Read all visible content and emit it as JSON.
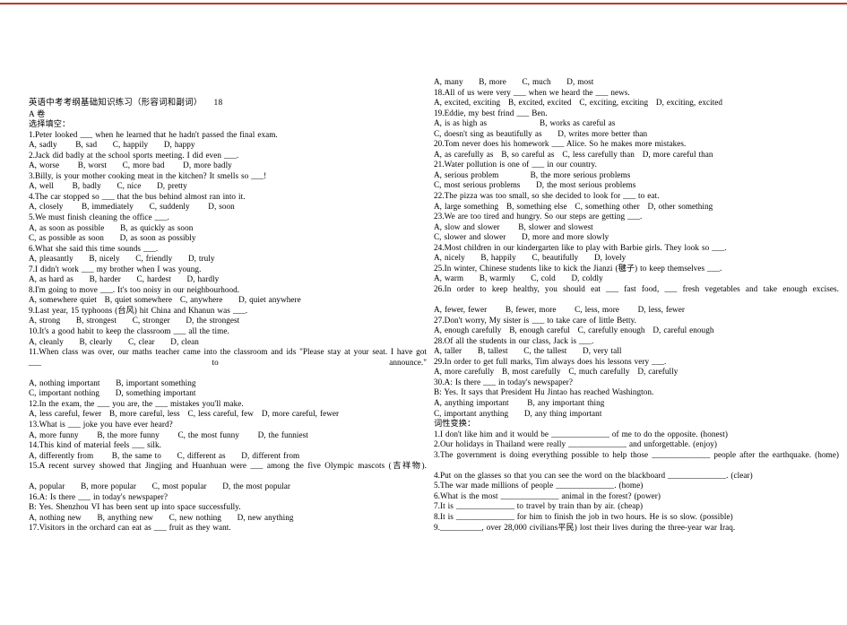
{
  "document": {
    "title": "英语中考考纲基础知识练习（形容词和副词）",
    "page_number": "18",
    "section_a": "A 卷",
    "section_a_heading": "选择填空：",
    "word_form_heading": "词性变换："
  },
  "left_column": {
    "lines": [
      "英语中考考纲基础知识练习（形容词和副词）    18",
      "A 卷",
      "选择填空：",
      "1.Peter looked ___ when he learned that he hadn't passed the final exam.",
      "A, sadly       B, sad      C, happily      D, happy",
      "2.Jack did badly at the school sports meeting. I did even ___.",
      "A, worse       B, worst      C, more bad       D, more badly",
      "3.Billy, is your mother cooking meat in the kitchen? It smells so ___!",
      "A, well       B, badly      C, nice      D, pretty",
      "4.The car stopped so ___ that the bus behind almost ran into it.",
      "A, closely       B, immediately      C, suddenly       D, soon",
      "5.We must finish cleaning the office ___.",
      "A, as soon as possible      B, as quickly as soon",
      "C, as possible as soon      D, as soon as possibly",
      "6.What she said this time sounds ___.",
      "A, pleasantly      B, nicely      C, friendly      D, truly",
      "7.I didn't work ___ my brother when I was young.",
      "A, as hard as      B, harder      C, hardest      D, hardly",
      "8.I'm going to move ___. It's too noisy in our neighbourhood.",
      "A, somewhere quiet   B, quiet somewhere   C, anywhere      D, quiet anywhere",
      "9.Last year, 15 typhoons (台风) hit China and Khanun was ___.",
      "A, strong      B, strongest      C, stronger      D, the strongest",
      "10.It's a good habit to keep the classroom ___ all the time.",
      "A, cleanly      B, clearly      C, clear      D, clean",
      "11.When class was over, our maths teacher came into the classroom and ids \"Please stay at your seat. I have got ___ to announce.\"",
      "A, nothing important      B, important something",
      "C, important nothing      D, something important",
      "12.In the exam, the ___ you are, the ___ mistakes you'll make.",
      "A, less careful, fewer   B, more careful, less   C, less careful, few   D, more careful, fewer",
      "13.What is ___ joke you have ever heard?",
      "A, more funny       B, the more funny       C, the most funny       D, the funniest",
      "14.This kind of material feels ___ silk.",
      "A, differently from       B, the same to      C, different as      D, different from",
      "15.A recent survey showed that Jingjing and Huanhuan were ___ among the five Olympic mascots (吉祥物).",
      "A, popular      B, more popular      C, most popular      D, the most popular",
      "16.A: Is there ___ in today's newspaper?",
      "B: Yes. Shenzhou VI has been sent up into space successfully.",
      "A, nothing new      B, anything new      C, new nothing      D, new anything",
      "17.Visitors in the orchard can eat as ___ fruit as they want."
    ]
  },
  "right_column": {
    "lines": [
      "A, many      B, more      C, much      D, most",
      "18.All of us were very ___ when we heard the ___ news.",
      "A, excited, exciting   B, excited, excited   C, exciting, exciting   D, exciting, excited",
      "19.Eddie, my best frind ___ Ben.",
      "A, is as high as                    B, works as careful as",
      "C, doesn't sing as beautifully as      D, writes more better than",
      "20.Tom never does his homework ___ Alice. So he makes more mistakes.",
      "A, as carefully as   B, so careful as   C, less carefully than   D, more careful than",
      "21.Water pollution is one of ___ in our country.",
      "A, serious problem            B, the more serious problems",
      "C, most serious problems      D, the most serious problems",
      "22.The pizza was too small, so she decided to look for ___ to eat.",
      "A, large something   B, something else   C, something other   D, other something",
      "23.We are too tired and hungry. So our steps are getting ___.",
      "A, slow and slower       B, slower and slowest",
      "C, slower and slower      D, more and more slowly",
      "24.Most children in our kindergarten like to play with Barbie girls. They look so ___.",
      "A, nicely      B, happily      C, beautifully      D, lovely",
      "25.In winter, Chinese students like to kick the Jianzi (毽子) to keep themselves ___.",
      "A, warm      B, warmly      C, cold      D, coldly",
      "26.In order to keep healthy, you should eat ___ fast food, ___ fresh vegetables and take enough excises.",
      "A, fewer, fewer       B, fewer, more       C, less, more       D, less, fewer",
      "27.Don't worry, My sister is ___ to take care of little Betty.",
      "A, enough carefully   B, enough careful   C, carefully enough   D, careful enough",
      "28.Of all the students in our class, Jack is ___.",
      "A, taller      B, tallest      C, the tallest      D, very tall",
      "29.In order to get full marks, Tim always does his lessons very ___.",
      "A, more carefully   B, most carefully   C, much carefully   D, carefully",
      "30.A: Is there ___ in today's newspaper?",
      "B: Yes. It says that President Hu Jintao has reached Washington.",
      "A, anything important       B, any important thing",
      "C, important anything      D, any thing important",
      "词性变换：",
      "1.I don't like him and it would be ______________ of me to do the opposite. (honest)",
      "2.Our holidays in Thailand were really ______________ and unforgettable. (enjoy)",
      "3.The government is doing everything possible to help those ______________ people after the earthquake. (home)",
      "4.Put on the glasses so that you can see the word on the blackboard ______________. (clear)",
      "5.The war made millions of people ______________. (home)",
      "6.What is the most ______________ animal in the forest? (power)",
      "7.It is ______________ to travel by train than by air. (cheap)",
      "8.It is ______________ for him to finish the job in two hours. He is so slow. (possible)",
      "9.__________, over 28,000 civilians平民) lost their lives during the three-year war Iraq."
    ]
  },
  "colors": {
    "top_rule": "#c0392b",
    "text": "#000000",
    "background": "#ffffff"
  }
}
